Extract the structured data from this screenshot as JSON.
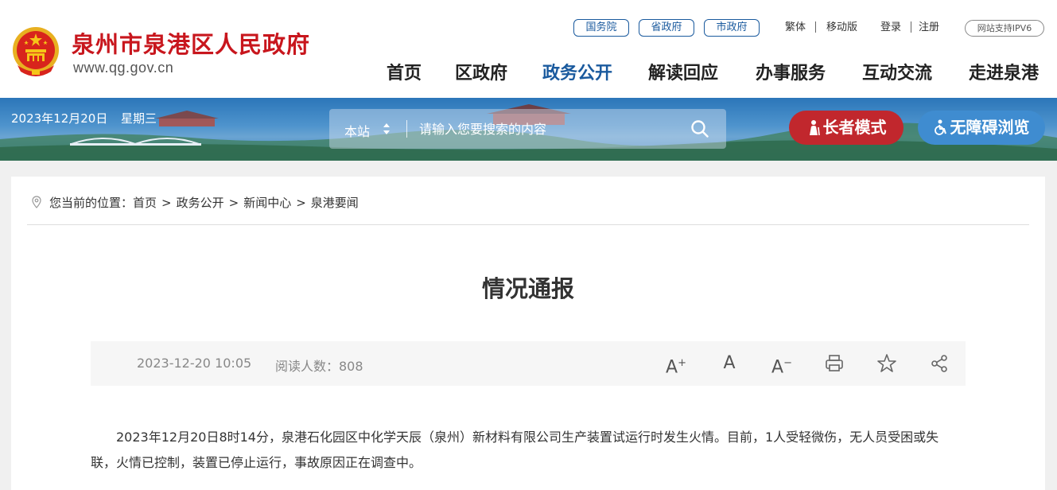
{
  "header": {
    "site_name": "泉州市泉港区人民政府",
    "site_url": "www.qg.gov.cn",
    "gov_links": [
      "国务院",
      "省政府",
      "市政府"
    ],
    "top_links": {
      "traditional": "繁体",
      "mobile": "移动版",
      "login": "登录",
      "register": "注册"
    },
    "ipv6_badge": "网站支持IPV6",
    "nav": [
      "首页",
      "区政府",
      "政务公开",
      "解读回应",
      "办事服务",
      "互动交流",
      "走进泉港"
    ],
    "nav_active": "政务公开"
  },
  "banner": {
    "date": "2023年12月20日",
    "weekday": "星期三",
    "search_scope": "本站",
    "search_placeholder": "请输入您要搜索的内容",
    "elder_mode": "长者模式",
    "accessibility": "无障碍浏览"
  },
  "breadcrumb": {
    "prefix": "您当前的位置：",
    "items": [
      "首页",
      "政务公开",
      "新闻中心",
      "泉港要闻"
    ]
  },
  "article": {
    "title": "情况通报",
    "published": "2023-12-20 10:05",
    "read_count": "阅读人数：808",
    "tools": [
      "font-larger-icon",
      "font-normal-icon",
      "font-smaller-icon",
      "print-icon",
      "favorite-star-icon",
      "share-icon"
    ],
    "body": "2023年12月20日8时14分，泉港石化园区中化学天辰（泉州）新材料有限公司生产装置试运行时发生火情。目前，1人受轻微伤，无人员受困或失联，火情已控制，装置已停止运行，事故原因正在调查中。"
  },
  "colors": {
    "brand_red": "#c8161d",
    "nav_active_blue": "#1a5a9e",
    "elder_button": "#c1272d",
    "access_button": "#3f8cd0"
  }
}
